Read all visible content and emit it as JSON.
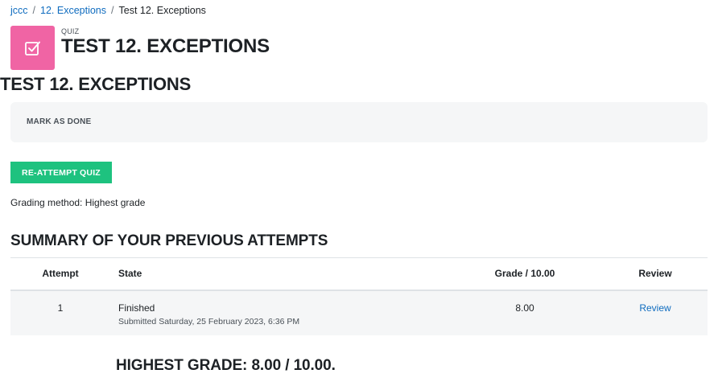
{
  "breadcrumb": [
    {
      "label": "jccc"
    },
    {
      "label": "12. Exceptions"
    },
    {
      "label": "Test 12. Exceptions"
    }
  ],
  "breadcrumb_separator": "/",
  "header": {
    "activity_type": "QUIZ",
    "title": "TEST 12. EXCEPTIONS",
    "icon": "quiz-checkbox-icon",
    "icon_bg_color": "#f064a4"
  },
  "main": {
    "section_title": "TEST 12. EXCEPTIONS",
    "mark_done_label": "MARK AS DONE",
    "reattempt_label": "RE-ATTEMPT QUIZ",
    "reattempt_color": "#1ec27f",
    "grading_method": "Grading method: Highest grade",
    "summary_title": "SUMMARY OF YOUR PREVIOUS ATTEMPTS",
    "table": {
      "headers": [
        "Attempt",
        "State",
        "Grade / 10.00",
        "Review"
      ],
      "rows": [
        {
          "attempt": "1",
          "state": "Finished",
          "submitted": "Submitted Saturday, 25 February 2023, 6:36 PM",
          "grade": "8.00",
          "review": "Review"
        }
      ]
    },
    "highest_grade": "HIGHEST GRADE: 8.00 / 10.00."
  }
}
